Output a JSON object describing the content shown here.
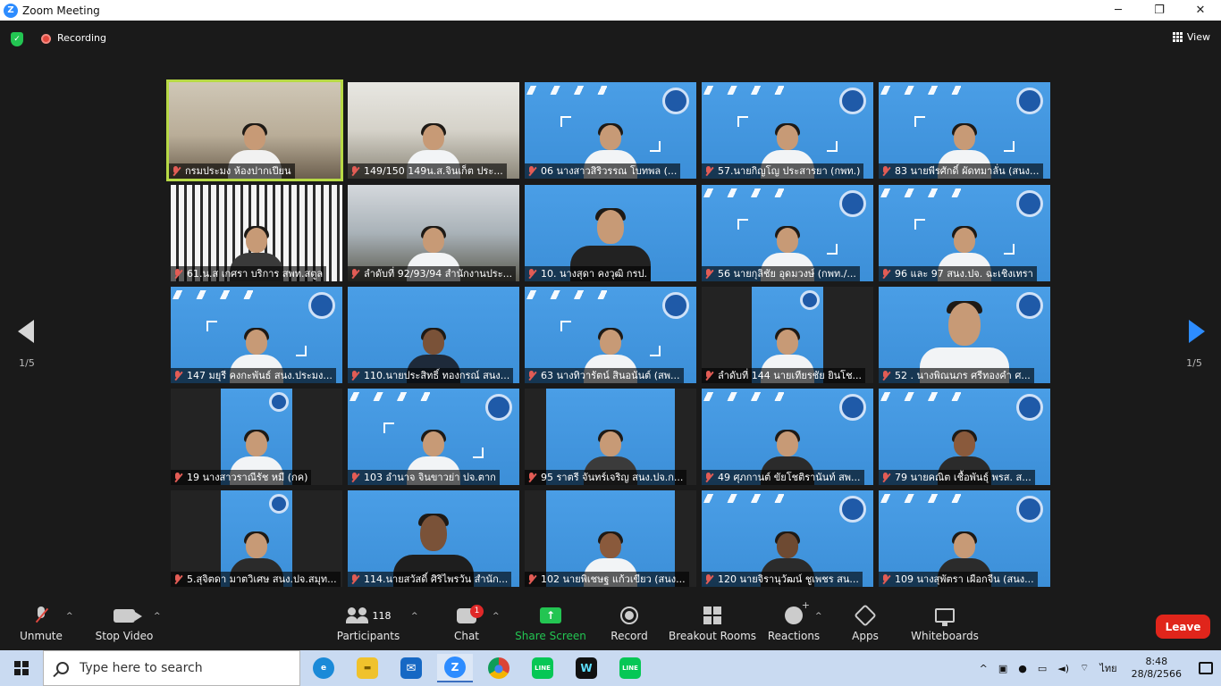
{
  "window": {
    "title": "Zoom Meeting",
    "logo_letter": "Z",
    "min": "─",
    "max": "❐",
    "close": "✕"
  },
  "meeting": {
    "recording_label": "Recording",
    "view_label": "View",
    "page_left": "1/5",
    "page_right": "1/5"
  },
  "tiles": [
    "กรมประมง ห้องปากเปียน",
    "149/150  149น.ส.จินเก็ต ประ...",
    "06 นางสาวสิริวรรณ โบทพล (...",
    "57.นายกิญโญ ประสารยา (กพท.)",
    "83 นายพีรศักดิ์ ผัดทมาลั่น (สนง...",
    "61.น.ส เกศรา บริการ สพท.สตูล",
    "ลำดับที่ 92/93/94 สำนักงานประ...",
    "10. นางสุดา คงวุฒิ กรป.",
    "56 นายกุลิชัย อุดมวงษ์ (กพท./...",
    "96 และ 97 สนง.ปจ. ฉะเชิงเทรา",
    "147 มยุรี คงกะพันธ์ สนง.ประมง...",
    "110.นายประสิทธิ์ ทองกรณ์ สนง...",
    "63 นางทิวารัตน์ สินอนันต์ (สพ...",
    "ลำดับที่ 144 นายเทียรชัย ยินโช...",
    "52 . นางพิณนภร ศรีทองคำ  ศ...",
    "19 นางสาวราณีรัช  หมี  (กค)",
    "103 อำนาจ  จินขาวย่า ปจ.ตาก",
    "95 ราตรี จันทร์เจริญ สนง.ปจ.ก...",
    "49 ศุภกานต์ ขัยโชติรานันท์ สพ...",
    "79 นายคณิต เชื้อพันธุ์ พรส. ส...",
    "5.สุจิตดา มาตวิเศษ สนง.ปจ.สมุท...",
    "114.นายสวัสดิ์ ศิริไพรวัน สำนัก...",
    "102 นายพิเชษฐ แก้วเขียว (สนง...",
    "120 นายจิรานุวัฒน์ ชูเพชร สน...",
    "109 นางสุพัตรา  เผือกจีน (สนง..."
  ],
  "toolbar": {
    "unmute": "Unmute",
    "stop_video": "Stop Video",
    "participants": "Participants",
    "participants_count": "118",
    "chat": "Chat",
    "chat_badge": "1",
    "share": "Share Screen",
    "share_glyph": "↑",
    "record": "Record",
    "rooms": "Breakout Rooms",
    "reactions": "Reactions",
    "apps": "Apps",
    "whiteboards": "Whiteboards",
    "leave": "Leave",
    "caret": "^"
  },
  "taskbar": {
    "search_placeholder": "Type here to search",
    "tray_lang": "ไทย",
    "tray_caret": "^",
    "time": "8:48",
    "date": "28/8/2566",
    "apps": [
      "edge-icon",
      "file-explorer-icon",
      "mail-icon",
      "zoom-icon",
      "chrome-icon",
      "line-icon",
      "webex-icon",
      "line-icon"
    ],
    "app_glyphs": [
      "e",
      "▬",
      "✉",
      "Z",
      "●",
      "LINE",
      "W",
      "LINE"
    ]
  },
  "colors": {
    "accent": "#2d8cff",
    "leave": "#e0251b",
    "share": "#23c552",
    "selected_tile": "#b7d946",
    "taskbar": "#c9daf1"
  }
}
